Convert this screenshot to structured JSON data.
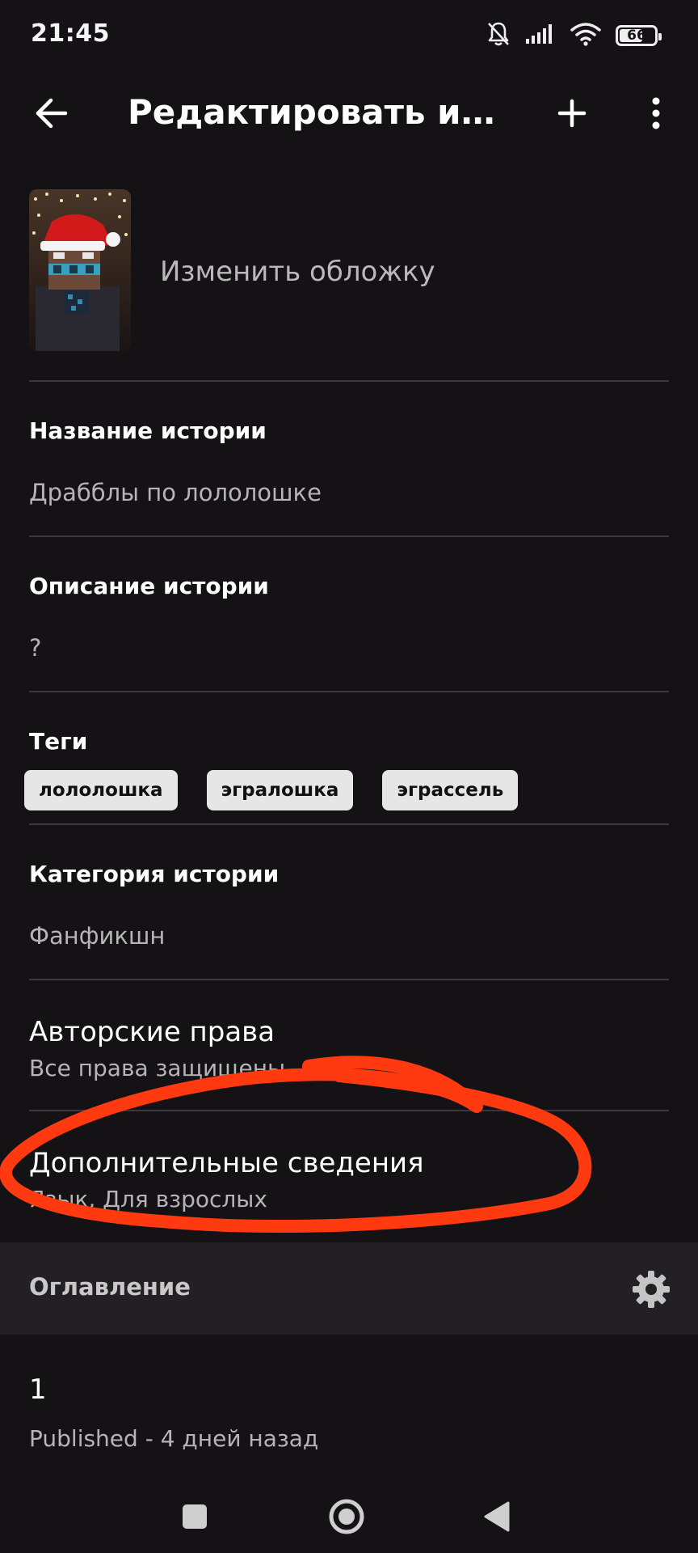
{
  "status_bar": {
    "time": "21:45",
    "battery": "66",
    "battery_level": 0.66,
    "icons": [
      "bell-off-icon",
      "signal-icon",
      "wifi-icon",
      "battery-icon"
    ]
  },
  "app_bar": {
    "title": "Редактировать история",
    "icons": [
      "back-arrow-icon",
      "plus-icon",
      "more-vertical-icon"
    ]
  },
  "cover": {
    "label": "Изменить обложку"
  },
  "story_title": {
    "label": "Название истории",
    "value": "Драбблы по лололошке"
  },
  "story_description": {
    "label": "Описание истории",
    "value": "?"
  },
  "tags": {
    "label": "Теги",
    "items": [
      "лололошка",
      "эгралошка",
      "эграссель"
    ]
  },
  "category": {
    "label": "Категория истории",
    "value": "Фанфикшн"
  },
  "copyright": {
    "label": "Авторские права",
    "value": "Все права защищены"
  },
  "additional_info": {
    "label": "Дополнительные сведения",
    "value": "Язык, Для взрослых"
  },
  "toc": {
    "label": "Оглавление"
  },
  "chapters": [
    {
      "title": "1",
      "status": "Published - 4 дней назад"
    }
  ],
  "colors": {
    "background": "#141215",
    "divider": "#3a383c",
    "toc_bar": "#222024",
    "tag_bg": "#e6e6e6",
    "annotation": "#ff3a10"
  }
}
